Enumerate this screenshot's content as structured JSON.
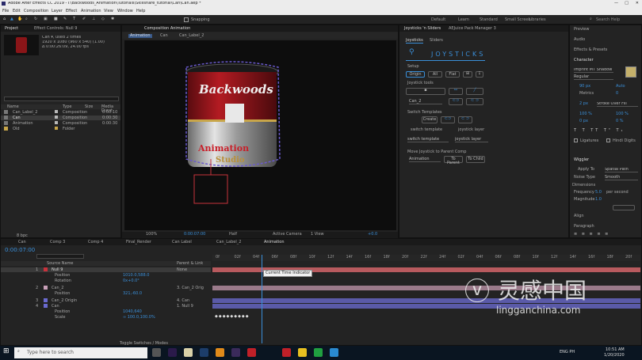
{
  "window_title": "Adobe After Effects CC 2019 - I:\\Backwoods_Animation\\Tutorials\\Skillshare_tutorial\\Can\\Can.aep *",
  "menu": [
    "File",
    "Edit",
    "Composition",
    "Layer",
    "Effect",
    "Animation",
    "View",
    "Window",
    "Help"
  ],
  "workspaces": [
    "Default",
    "Learn",
    "Standard",
    "Small Screen",
    "Libraries"
  ],
  "toolbar_snapping": "Snapping",
  "search_help": "Search Help",
  "project": {
    "tab": "Project",
    "effect_tab": "Effect Controls: Null 9",
    "info": [
      "Can ▾, used 2 times",
      "1920 x 1080 (960 x 540) (1.00)",
      "Δ 0:00:26:09, 24.00 fps"
    ],
    "columns": [
      "Name",
      "Type",
      "Size",
      "Media Durat"
    ],
    "items": [
      {
        "name": "Can_Label_2",
        "type": "Composition",
        "dur": "0:00:10"
      },
      {
        "name": "Can",
        "type": "Composition",
        "dur": "0:00:30"
      },
      {
        "name": "Animation",
        "type": "Composition",
        "dur": "0:00:30"
      },
      {
        "name": "Old",
        "type": "Folder",
        "dur": ""
      }
    ],
    "footer": "8 bpc"
  },
  "composition": {
    "tab": "Composition Animation",
    "crumbs": [
      "Animation",
      "Can",
      "Can_Label_2"
    ],
    "zoom": "100%",
    "time": "0:00:07:00",
    "res": "Half",
    "camera": "Active Camera",
    "views": "1 View",
    "offset": "+0.0",
    "can_lines": [
      "Backwoods",
      "Animation",
      "Studio"
    ]
  },
  "joysticks": {
    "tab": "Joysticks 'n Sliders",
    "tab2": "AEJuice Pack Manager 3",
    "subtabs": [
      "Joysticks",
      "Sliders"
    ],
    "title": "JOYSTICKS",
    "setup": "Setup",
    "origin": "Origin",
    "all": "All",
    "flat": "Flat",
    "tools": "Joystick tools",
    "layer_sel": "Can_2",
    "switch_templates": "Switch Templates",
    "create": "Create",
    "switch_template": "switch template",
    "joystick_layer": "joystick layer",
    "switch_template_val": "switch template",
    "joystick_layer_val": "joystick layer",
    "move_title": "Move Joystick to Parent Comp",
    "move_comp": "Animation",
    "to_parent": "To Parent",
    "to_child": "To Child"
  },
  "right": {
    "sections": [
      "Preview",
      "Audio",
      "Effects & Presets",
      "Character"
    ],
    "font": "Imprint MT Shadow",
    "style": "Regular",
    "font_size": "90 px",
    "leading": "Auto",
    "tracking": "0",
    "metrics": "Metrics",
    "stroke": "Stroke Over Fill",
    "stroke_w": "2 px",
    "vert": "100 %",
    "horiz": "100 %",
    "baseline": "0 px",
    "tsume": "0 %",
    "ligatures": "Ligatures",
    "hindi": "Hindi Digits",
    "wiggler": "Wiggler",
    "apply_to": "Apply To",
    "apply_val": "Spatial Path",
    "noise": "Noise Type",
    "noise_val": "Smooth",
    "dimensions": "Dimensions",
    "frequency": "Frequency",
    "freq_val": "5.0",
    "per_second": "per second",
    "magnitude": "Magnitude",
    "mag_val": "1.0",
    "align": "Align",
    "paragraph": "Paragraph"
  },
  "timeline": {
    "tabs": [
      "Can",
      "Comp 3",
      "Comp 4",
      "Final_Render",
      "Can Label",
      "Can_Label_2",
      "Animation"
    ],
    "time": "0:00:07:00",
    "col_name": "Source Name",
    "col_parent": "Parent & Link",
    "rows": [
      {
        "num": "1",
        "name": "Null 9",
        "parent": "None",
        "sel": true
      },
      {
        "name": "Position",
        "val": "1010.0,588.0",
        "prop": true
      },
      {
        "name": "Rotation",
        "val": "0x+0.0°",
        "prop": true
      },
      {
        "num": "2",
        "name": "Can_2",
        "parent": "3. Can_2 Orig"
      },
      {
        "name": "Position",
        "val": "321,-60.0",
        "prop": true
      },
      {
        "num": "3",
        "name": "Can_2 Origin",
        "parent": "4. Can"
      },
      {
        "num": "4",
        "name": "Can",
        "parent": "1. Null 9"
      },
      {
        "name": "Position",
        "val": "1040,640",
        "prop": true
      },
      {
        "name": "Scale",
        "val": "∞ 100.0,100.0%",
        "prop": true
      }
    ],
    "ruler": [
      "0f",
      "02f",
      "04f",
      "06f",
      "08f",
      "10f",
      "12f",
      "14f",
      "16f",
      "18f",
      "20f",
      "22f",
      "24f",
      "02f",
      "04f",
      "06f",
      "08f",
      "10f",
      "12f",
      "14f",
      "16f",
      "18f",
      "20f"
    ],
    "tooltip": "Current Time Indicator",
    "toggle": "Toggle Switches / Modes"
  },
  "taskbar": {
    "search": "Type here to search",
    "lang": "ENG PH",
    "clock": "10:51 AM",
    "date": "1/20/2020"
  },
  "watermark": "灵感中国",
  "watermark_url": "lingganchina.com"
}
